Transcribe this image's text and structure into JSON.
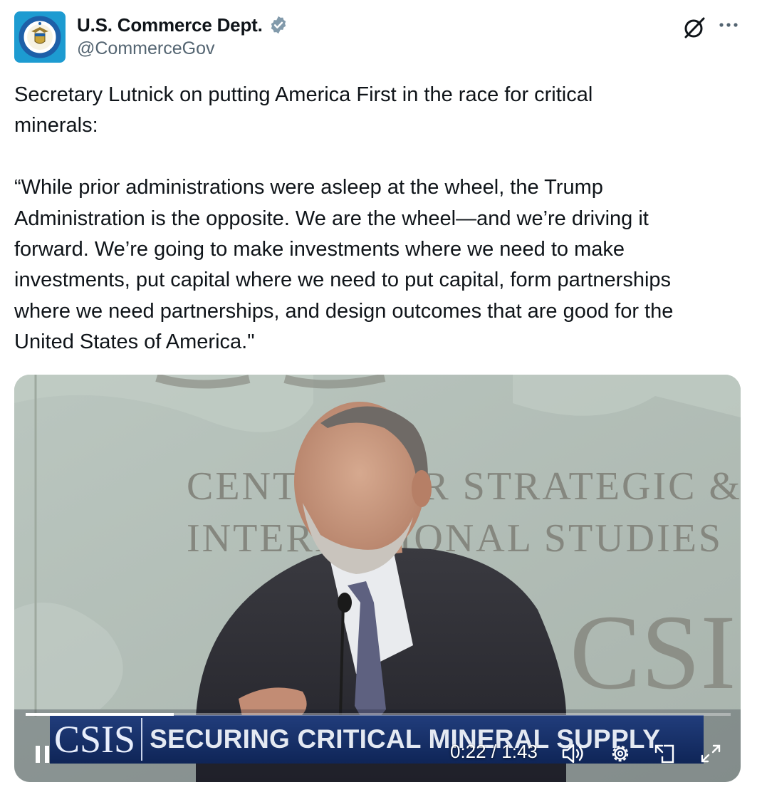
{
  "author": {
    "display_name": "U.S. Commerce Dept.",
    "handle": "@CommerceGov",
    "verified_icon": "verified-badge-icon",
    "avatar_icon": "department-of-commerce-seal",
    "avatar_seal_text": "DEPARTMENT OF COMMERCE · UNITED STATES OF AMERICA"
  },
  "header_actions": {
    "grok_icon": "grok-icon",
    "more_icon": "more-options-icon",
    "more_label": "···"
  },
  "tweet": {
    "text": "Secretary Lutnick on putting America First in the race for critical\nminerals:\n\n“While prior administrations were asleep at the wheel, the Trump\nAdministration is the opposite. We are the wheel—and we’re driving it\nforward. We’re going to make investments where we need to make\ninvestments, put capital where we need to put capital, form partnerships\nwhere we need partnerships, and design outcomes that are good for the\nUnited States of America.\""
  },
  "video": {
    "backdrop_line1": "CENTER FOR STRATEGIC &",
    "backdrop_line2": "INTERNATIONAL STUDIES",
    "backdrop_logo": "CSIS",
    "lower_third_logo": "CSIS",
    "lower_third_text": "SECURING CRITICAL MINERAL SUPPLY",
    "time_display": "0:22 / 1:43",
    "progress_fraction": 0.21,
    "controls": {
      "play_pause": "pause-icon",
      "volume": "volume-icon",
      "settings": "settings-gear-icon",
      "pip": "picture-in-picture-icon",
      "fullscreen": "fullscreen-icon"
    }
  }
}
